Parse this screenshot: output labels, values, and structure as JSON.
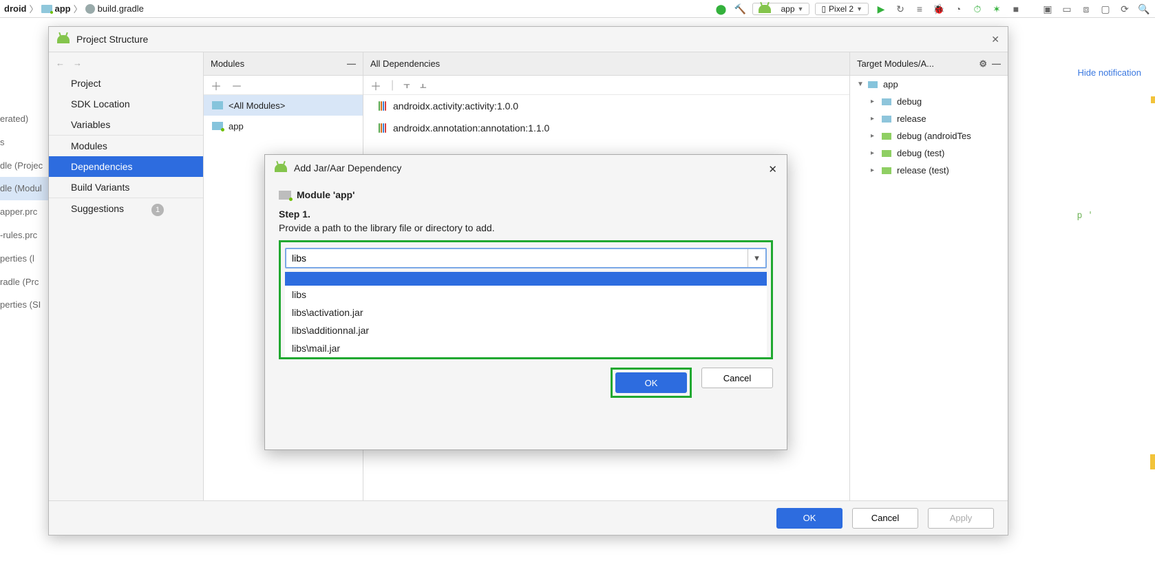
{
  "breadcrumb": {
    "seg0": "droid",
    "seg1": "app",
    "seg2": "build.gradle"
  },
  "topbar": {
    "run_config": "app",
    "device": "Pixel 2"
  },
  "hidenotif": "Hide notification",
  "proj_tree": {
    "r0": "erated)",
    "r1": "s",
    "r2": "dle (Projec",
    "r3": "dle (Modul",
    "r4": "apper.prc",
    "r5": "-rules.prc",
    "r6": "perties (l",
    "r7": "radle (Prc",
    "r8": "perties (SI"
  },
  "ps": {
    "title": "Project Structure",
    "nav": {
      "project": "Project",
      "sdk": "SDK Location",
      "vars": "Variables",
      "modules": "Modules",
      "deps": "Dependencies",
      "variants": "Build Variants",
      "sugg": "Suggestions",
      "badge": "1"
    },
    "modules_panel": {
      "title": "Modules",
      "all": "<All Modules>",
      "app": "app"
    },
    "deps_panel": {
      "title": "All Dependencies",
      "row0": "androidx.activity:activity:1.0.0",
      "row1": "androidx.annotation:annotation:1.1.0"
    },
    "targets": {
      "title": "Target Modules/A...",
      "app": "app",
      "debug": "debug",
      "release": "release",
      "debugAT": "debug (androidTes",
      "debugT": "debug (test)",
      "releaseT": "release (test)"
    },
    "foot": {
      "ok": "OK",
      "cancel": "Cancel",
      "apply": "Apply"
    }
  },
  "jar": {
    "title": "Add Jar/Aar Dependency",
    "module": "Module 'app'",
    "step_lbl": "Step 1.",
    "step_txt": "Provide a path to the library file or directory to add.",
    "input_value": "libs",
    "opts": {
      "o0": "",
      "o1": "libs",
      "o2": "libs\\activation.jar",
      "o3": "libs\\additionnal.jar",
      "o4": "libs\\mail.jar"
    },
    "ok": "OK",
    "cancel": "Cancel"
  },
  "phantom": "p '"
}
